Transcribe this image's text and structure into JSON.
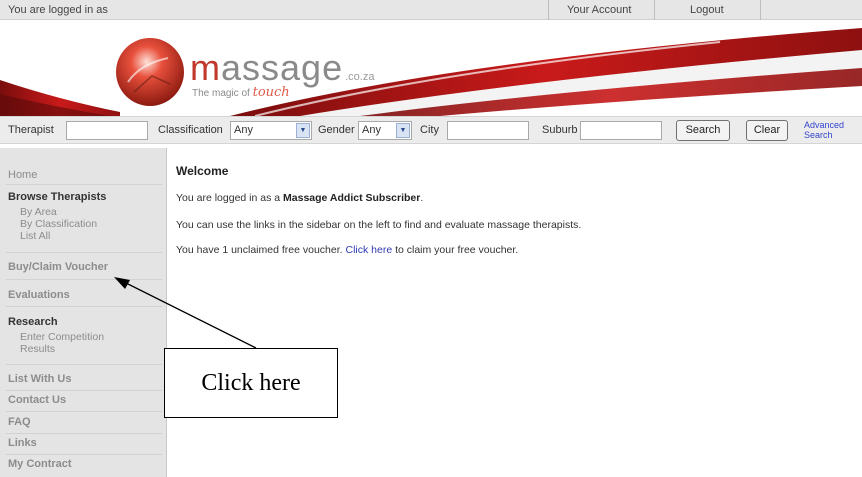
{
  "topbar": {
    "logged_in_text": "You are logged in as",
    "your_account": "Your Account",
    "logout": "Logout"
  },
  "banner": {
    "brand_prefix": "m",
    "brand_rest": "assage",
    "brand_tld": ".co.za",
    "tagline_prefix": "The magic of",
    "tagline_script": "touch"
  },
  "search": {
    "therapist_label": "Therapist",
    "classification_label": "Classification",
    "classification_value": "Any",
    "gender_label": "Gender",
    "gender_value": "Any",
    "city_label": "City",
    "suburb_label": "Suburb",
    "search_button": "Search",
    "clear_button": "Clear",
    "advanced_line1": "Advanced",
    "advanced_line2": "Search"
  },
  "sidebar": {
    "home": "Home",
    "browse_therapists": "Browse Therapists",
    "by_area": "By Area",
    "by_classification": "By Classification",
    "list_all": "List All",
    "buy_claim_voucher": "Buy/Claim Voucher",
    "evaluations": "Evaluations",
    "research": "Research",
    "enter_competition": "Enter Competition",
    "results": "Results",
    "list_with_us": "List With Us",
    "contact_us": "Contact Us",
    "faq": "FAQ",
    "links": "Links",
    "my_contract": "My Contract"
  },
  "main": {
    "title": "Welcome",
    "line1_prefix": "You are logged in as a ",
    "line1_bold": "Massage Addict Subscriber",
    "line1_suffix": ".",
    "line2": "You can use the links in the sidebar on the left to find and evaluate massage therapists.",
    "line3_prefix": "You have 1 unclaimed free voucher. ",
    "line3_link": "Click here",
    "line3_suffix": " to claim your free voucher."
  },
  "annotation": {
    "callout_text": "Click here"
  },
  "colors": {
    "brand_red": "#c0392b",
    "link_blue": "#2f3bb0",
    "sidebar_bg": "#e4e4e4"
  }
}
